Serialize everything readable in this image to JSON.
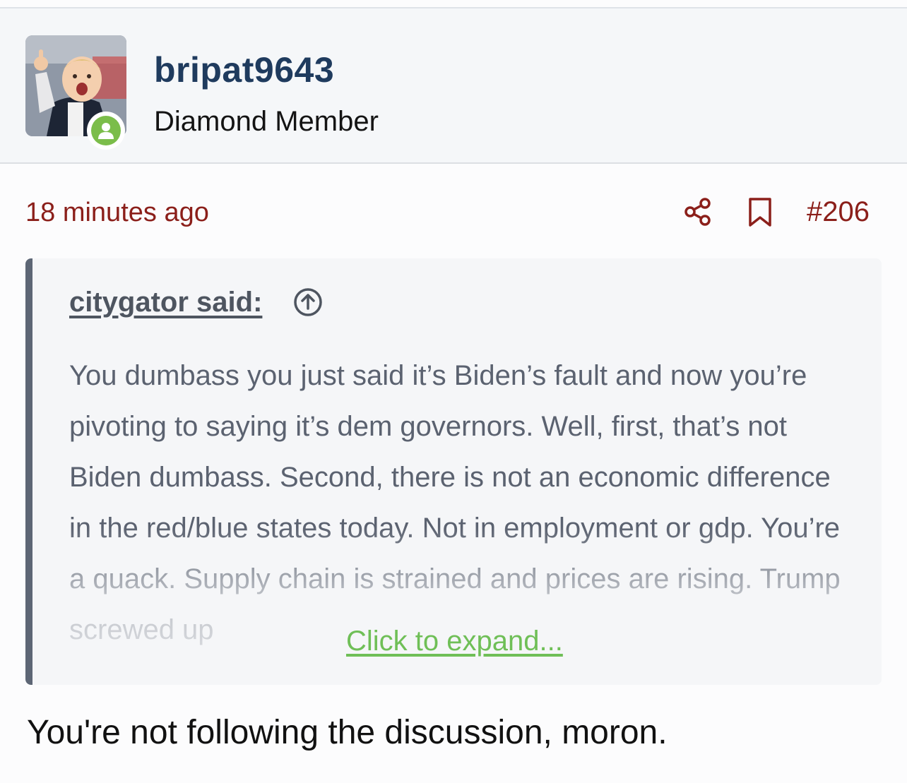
{
  "user": {
    "name": "bripat9643",
    "title": "Diamond Member",
    "status": "online"
  },
  "post": {
    "time": "18 minutes ago",
    "number": "#206",
    "actions": [
      "share-icon",
      "bookmark-icon"
    ]
  },
  "quote": {
    "author": "citygator said:",
    "text": "You dumbass you just said it’s Biden’s fault and now you’re pivoting to saying it’s dem governors. Well, first, that’s not Biden dumbass. Second, there is not an economic difference in the red/blue states today. Not in employment or gdp. You’re a quack. Supply chain is strained and prices are rising. Trump screwed up",
    "expand_label": "Click to expand..."
  },
  "reply": {
    "text": "You're not following the discussion, moron."
  },
  "colors": {
    "username": "#1f3b5e",
    "meta_red": "#8b1f1a",
    "quote_border": "#5d6675",
    "expand_green": "#6fbf57",
    "online_green": "#7bbd4a"
  }
}
